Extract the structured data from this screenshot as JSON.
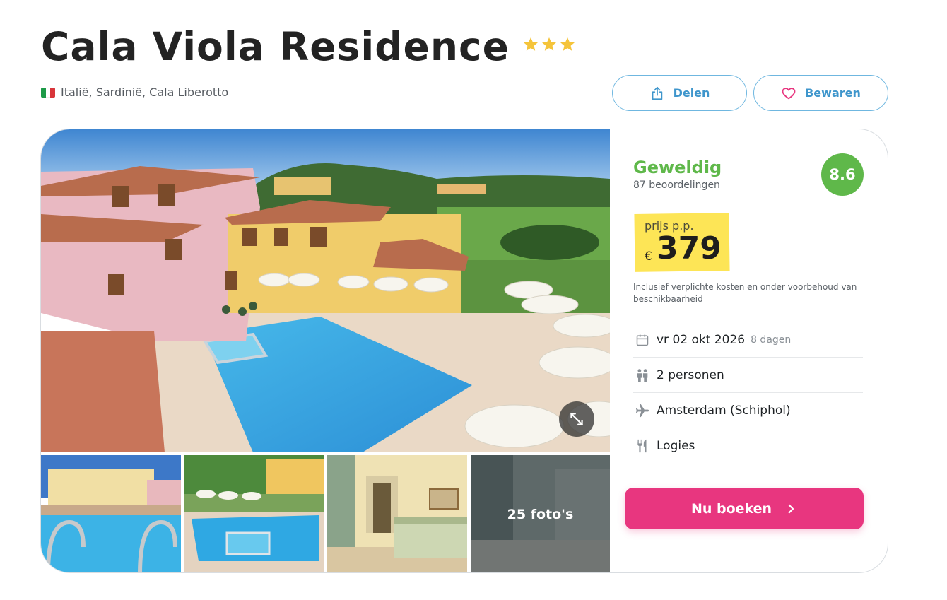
{
  "hotel": {
    "name": "Cala Viola Residence",
    "stars": 3,
    "location": "Italië, Sardinië, Cala Liberotto"
  },
  "actions": {
    "share_label": "Delen",
    "save_label": "Bewaren"
  },
  "gallery": {
    "more_photos_label": "25 foto's"
  },
  "rating": {
    "word": "Geweldig",
    "reviews": "87 beoordelingen",
    "score": "8.6"
  },
  "price": {
    "label": "prijs p.p.",
    "currency": "€",
    "amount": "379",
    "disclaimer": "Inclusief verplichte kosten en onder voorbehoud van beschikbaarheid"
  },
  "details": {
    "date": "vr 02 okt 2026",
    "duration": "8 dagen",
    "persons": "2 personen",
    "departure": "Amsterdam (Schiphol)",
    "board": "Logies"
  },
  "booking": {
    "button_label": "Nu boeken"
  },
  "colors": {
    "rating_green": "#5fb84a",
    "book_pink": "#e8367f",
    "price_yellow": "#fde556",
    "link_blue": "#3f96cc"
  },
  "icons": {
    "stars": "star-icon",
    "share": "share-icon",
    "save": "heart-icon",
    "expand": "expand-icon",
    "date": "calendar-icon",
    "persons": "people-icon",
    "departure": "plane-icon",
    "board": "cutlery-icon",
    "book": "chevron-right-icon"
  }
}
